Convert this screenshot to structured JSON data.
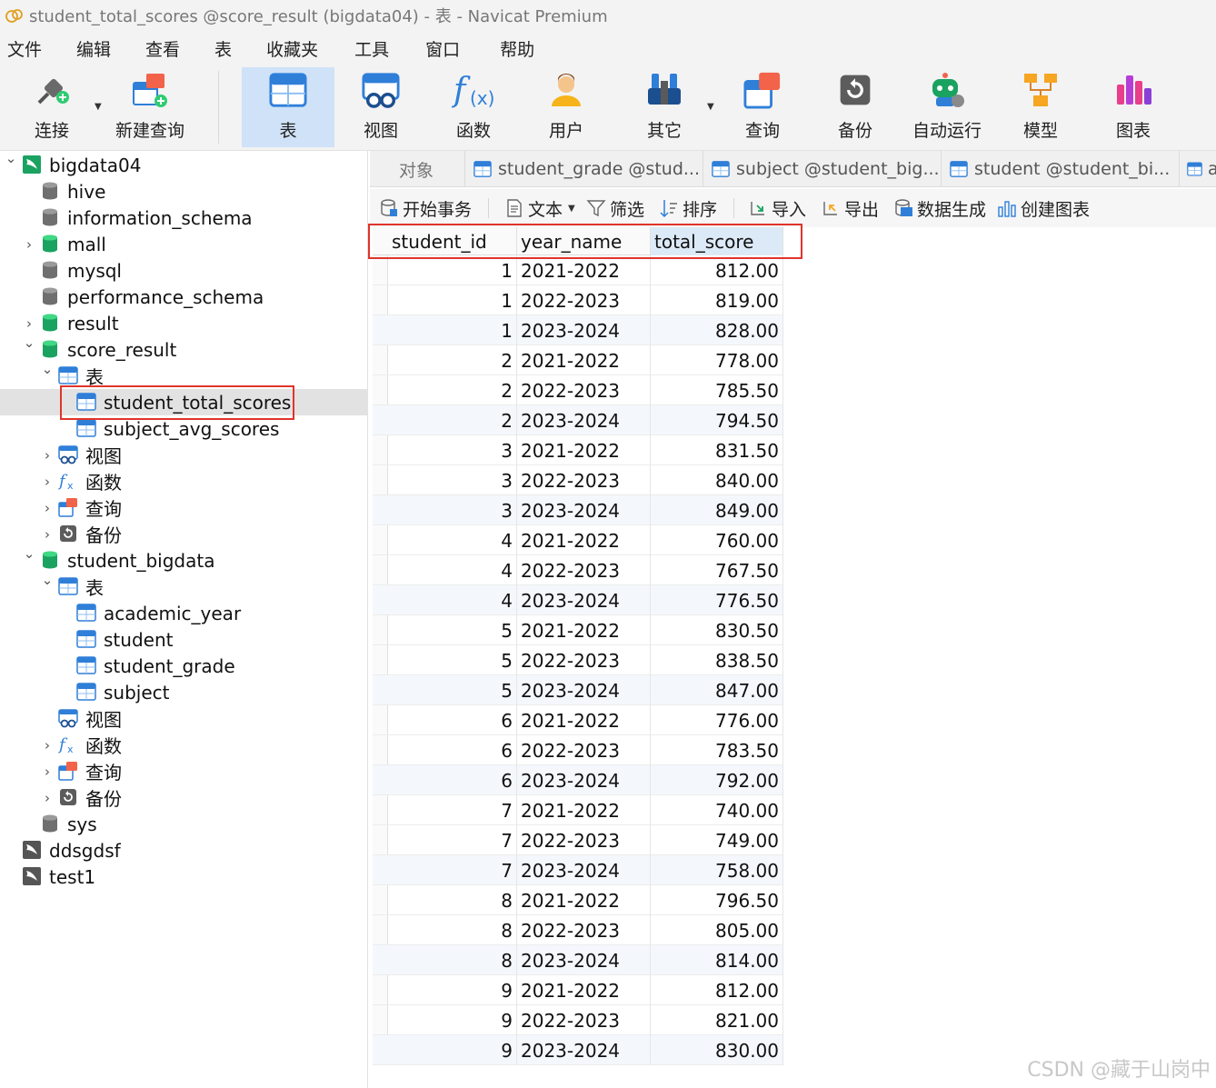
{
  "window": {
    "title": "student_total_scores @score_result (bigdata04) - 表 - Navicat Premium"
  },
  "menu": [
    "文件",
    "编辑",
    "查看",
    "表",
    "收藏夹",
    "工具",
    "窗口",
    "帮助"
  ],
  "toolbar": {
    "connect": "连接",
    "new_query": "新建查询",
    "table": "表",
    "view": "视图",
    "function": "函数",
    "user": "用户",
    "other": "其它",
    "query": "查询",
    "backup": "备份",
    "automation": "自动运行",
    "model": "模型",
    "chart": "图表",
    "active": "table"
  },
  "navigator": {
    "items": [
      {
        "label": "bigdata04",
        "type": "connection",
        "expanded": true
      },
      {
        "label": "hive",
        "type": "database-gray"
      },
      {
        "label": "information_schema",
        "type": "database-gray"
      },
      {
        "label": "mall",
        "type": "database",
        "collapsible": true
      },
      {
        "label": "mysql",
        "type": "database-gray"
      },
      {
        "label": "performance_schema",
        "type": "database-gray"
      },
      {
        "label": "result",
        "type": "database",
        "collapsible": true
      },
      {
        "label": "score_result",
        "type": "database",
        "expanded": true
      },
      {
        "label": "表",
        "type": "tables-folder",
        "expanded": true
      },
      {
        "label": "student_total_scores",
        "type": "table",
        "selected": true
      },
      {
        "label": "subject_avg_scores",
        "type": "table"
      },
      {
        "label": "视图",
        "type": "views-folder",
        "collapsible": true
      },
      {
        "label": "函数",
        "type": "functions-folder",
        "collapsible": true
      },
      {
        "label": "查询",
        "type": "queries-folder",
        "collapsible": true
      },
      {
        "label": "备份",
        "type": "backups-folder",
        "collapsible": true
      },
      {
        "label": "student_bigdata",
        "type": "database",
        "expanded": true
      },
      {
        "label": "表",
        "type": "tables-folder",
        "expanded": true
      },
      {
        "label": "academic_year",
        "type": "table"
      },
      {
        "label": "student",
        "type": "table"
      },
      {
        "label": "student_grade",
        "type": "table"
      },
      {
        "label": "subject",
        "type": "table"
      },
      {
        "label": "视图",
        "type": "views-folder"
      },
      {
        "label": "函数",
        "type": "functions-folder",
        "collapsible": true
      },
      {
        "label": "查询",
        "type": "queries-folder",
        "collapsible": true
      },
      {
        "label": "备份",
        "type": "backups-folder",
        "collapsible": true
      },
      {
        "label": "sys",
        "type": "database-gray"
      },
      {
        "label": "ddsgdsf",
        "type": "connection-gray"
      },
      {
        "label": "test1",
        "type": "connection-gray"
      }
    ]
  },
  "tabs": [
    {
      "label": "对象"
    },
    {
      "label": "student_grade @stud..."
    },
    {
      "label": "subject @student_big..."
    },
    {
      "label": "student @student_bi..."
    },
    {
      "label": "a"
    }
  ],
  "subtoolbar": {
    "begin_transaction": "开始事务",
    "text": "文本",
    "filter": "筛选",
    "sort": "排序",
    "import": "导入",
    "export": "导出",
    "data_generation": "数据生成",
    "create_chart": "创建图表"
  },
  "grid": {
    "columns": [
      "student_id",
      "year_name",
      "total_score"
    ],
    "current_row_index": 20,
    "rows": [
      [
        "1",
        "2021-2022",
        "812.00"
      ],
      [
        "1",
        "2022-2023",
        "819.00"
      ],
      [
        "1",
        "2023-2024",
        "828.00"
      ],
      [
        "2",
        "2021-2022",
        "778.00"
      ],
      [
        "2",
        "2022-2023",
        "785.50"
      ],
      [
        "2",
        "2023-2024",
        "794.50"
      ],
      [
        "3",
        "2021-2022",
        "831.50"
      ],
      [
        "3",
        "2022-2023",
        "840.00"
      ],
      [
        "3",
        "2023-2024",
        "849.00"
      ],
      [
        "4",
        "2021-2022",
        "760.00"
      ],
      [
        "4",
        "2022-2023",
        "767.50"
      ],
      [
        "4",
        "2023-2024",
        "776.50"
      ],
      [
        "5",
        "2021-2022",
        "830.50"
      ],
      [
        "5",
        "2022-2023",
        "838.50"
      ],
      [
        "5",
        "2023-2024",
        "847.00"
      ],
      [
        "6",
        "2021-2022",
        "776.00"
      ],
      [
        "6",
        "2022-2023",
        "783.50"
      ],
      [
        "6",
        "2023-2024",
        "792.00"
      ],
      [
        "7",
        "2021-2022",
        "740.00"
      ],
      [
        "7",
        "2022-2023",
        "749.00"
      ],
      [
        "7",
        "2023-2024",
        "758.00"
      ],
      [
        "8",
        "2021-2022",
        "796.50"
      ],
      [
        "8",
        "2022-2023",
        "805.00"
      ],
      [
        "8",
        "2023-2024",
        "814.00"
      ],
      [
        "9",
        "2021-2022",
        "812.00"
      ],
      [
        "9",
        "2022-2023",
        "821.00"
      ],
      [
        "9",
        "2023-2024",
        "830.00"
      ]
    ]
  },
  "watermark": "CSDN @藏于山岗中",
  "colors": {
    "accent_blue": "#2f7fd9",
    "db_green": "#1aa260",
    "highlight_red": "#e0342b",
    "selected_bg": "#e2e2e2",
    "active_tool_bg": "#cfe2f7"
  }
}
